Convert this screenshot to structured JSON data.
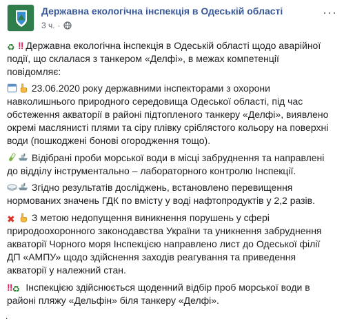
{
  "header": {
    "page_name": "Державна екологічна інспекція в Одеській області",
    "time": "3 ч.",
    "separator": "·",
    "audience_icon": "globe-icon",
    "menu": "···"
  },
  "post": {
    "paragraphs": [
      {
        "icons": [
          "recycle-icon",
          "double-exclamation-icon"
        ],
        "text": "Державна екологічна інспекція в Одеській області щодо аварійної події, що склалася з танкером «Делфі», в межах компетенції повідомляє:"
      },
      {
        "icons": [
          "calendar-icon",
          "pointing-hand-icon"
        ],
        "text": "23.06.2020 року державними інспекторами з охорони навколишнього природного середовища Одеської області, під час обстеження акваторії в районі підтопленого танкеру «Делфі», виявлено окремі маслянисті плями та сіру плівку сріблястого кольору на поверхні води (пошкоджені бонові огородження тощо)."
      },
      {
        "icons": [
          "test-tube-icon",
          "ship-icon"
        ],
        "text": "Відібрані проби морської води в місці забруднення та направлені до відділу інструментально – лабораторного контролю Інспекції."
      },
      {
        "icons": [
          "oil-drum-icon",
          "ship-icon"
        ],
        "text": "Згідно результатів досліджень, встановлено перевищення нормованих значень ГДК по вмісту у воді нафтопродуктів у 2,2 разів."
      },
      {
        "icons": [
          "cross-mark-icon",
          "pointing-hand-icon"
        ],
        "text": "З метою недопущення виникнення порушень у сфері природоохоронного законодавства України та уникнення забруднення акваторії Чорного моря Інспекцією направлено лист до Одеської філії ДП «АМПУ» щодо здійснення заходів реагування та приведення акваторії у належний стан."
      },
      {
        "icons": [
          "double-exclamation-icon",
          "recycle-icon"
        ],
        "text": "Інспекцією здійснюється щоденний відбір проб морської води в районі пляжу «Дельфін» біля танкеру «Делфі»."
      }
    ]
  },
  "colors": {
    "link": "#385898",
    "meta": "#606770",
    "text": "#1c1e21"
  }
}
